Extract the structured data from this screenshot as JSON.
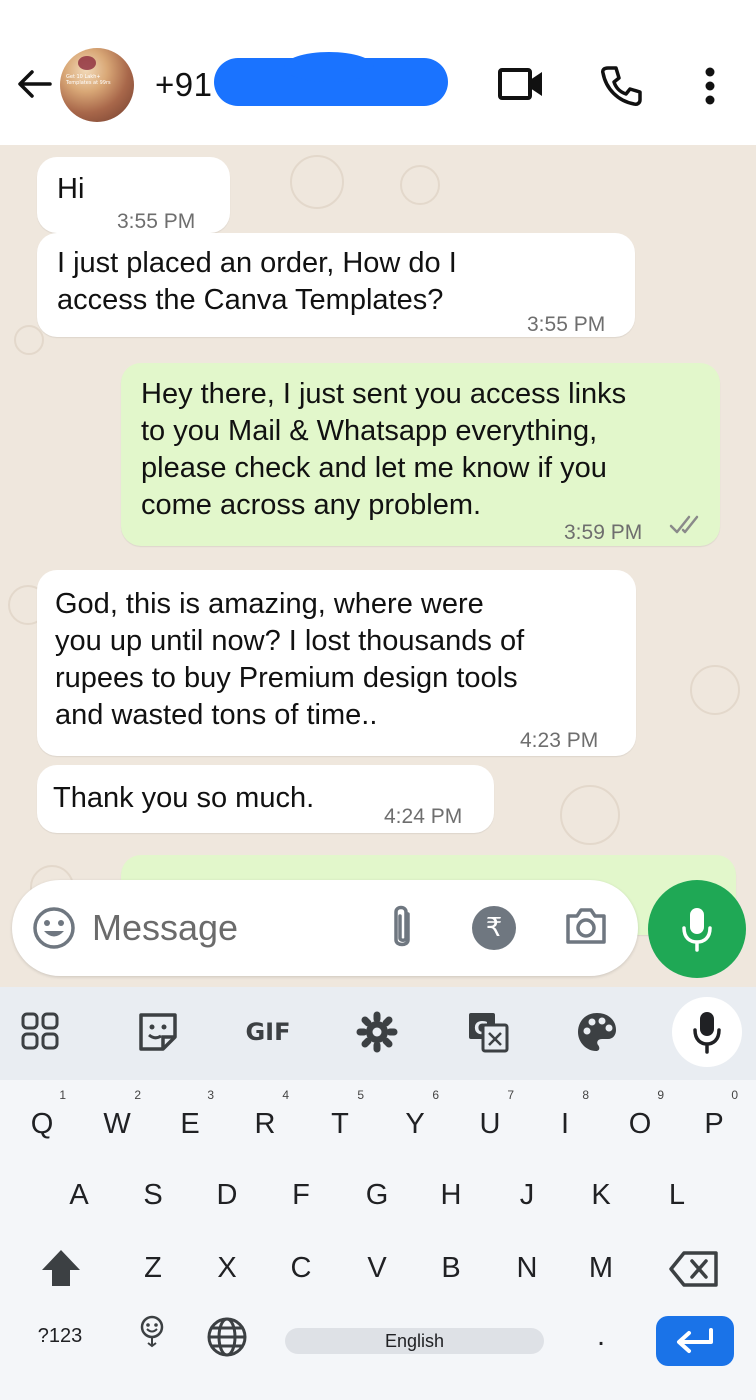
{
  "header": {
    "contact_name": "+91",
    "avatar_text": "Get 10 Lakh+ Templates at 99rs",
    "icons": [
      "back-arrow-icon",
      "video-call-icon",
      "voice-call-icon",
      "more-vert-icon"
    ]
  },
  "messages": [
    {
      "direction": "incoming",
      "text": "Hi",
      "time": "3:55 PM"
    },
    {
      "direction": "incoming",
      "lines": [
        "I just placed an order, How do I",
        "access the Canva Templates?"
      ],
      "time": "3:55 PM"
    },
    {
      "direction": "outgoing",
      "lines": [
        "Hey there, I just sent you access links",
        "to you Mail & Whatsapp everything,",
        "please check and let me know if you",
        "come across any problem."
      ],
      "time": "3:59 PM",
      "status": "delivered"
    },
    {
      "direction": "incoming",
      "lines": [
        "God, this is amazing, where were",
        "you up until now? I lost thousands of",
        "rupees to buy Premium design tools",
        "and wasted tons of time.."
      ],
      "time": "4:23 PM"
    },
    {
      "direction": "incoming",
      "text": "Thank you so much.",
      "time": "4:24 PM"
    }
  ],
  "compose": {
    "placeholder": "Message",
    "rupee_symbol": "₹",
    "icons": [
      "emoji-icon",
      "attach-icon",
      "rupee-payment-icon",
      "camera-icon",
      "mic-icon"
    ]
  },
  "keyboard": {
    "toolbar_gif": "GIF",
    "row1": [
      {
        "k": "Q",
        "s": "1"
      },
      {
        "k": "W",
        "s": "2"
      },
      {
        "k": "E",
        "s": "3"
      },
      {
        "k": "R",
        "s": "4"
      },
      {
        "k": "T",
        "s": "5"
      },
      {
        "k": "Y",
        "s": "6"
      },
      {
        "k": "U",
        "s": "7"
      },
      {
        "k": "I",
        "s": "8"
      },
      {
        "k": "O",
        "s": "9"
      },
      {
        "k": "P",
        "s": "0"
      }
    ],
    "row2": [
      "A",
      "S",
      "D",
      "F",
      "G",
      "H",
      "J",
      "K",
      "L"
    ],
    "row3": [
      "Z",
      "X",
      "C",
      "V",
      "B",
      "N",
      "M"
    ],
    "symbols_label": "?123",
    "space_label": "English",
    "period": "."
  },
  "colors": {
    "chat_background": "#efe7dd",
    "outgoing_bubble": "#e2f7cb",
    "incoming_bubble": "#ffffff",
    "mic_button": "#1fa855",
    "enter_key": "#1a73e8",
    "redaction": "#1a73ff"
  }
}
